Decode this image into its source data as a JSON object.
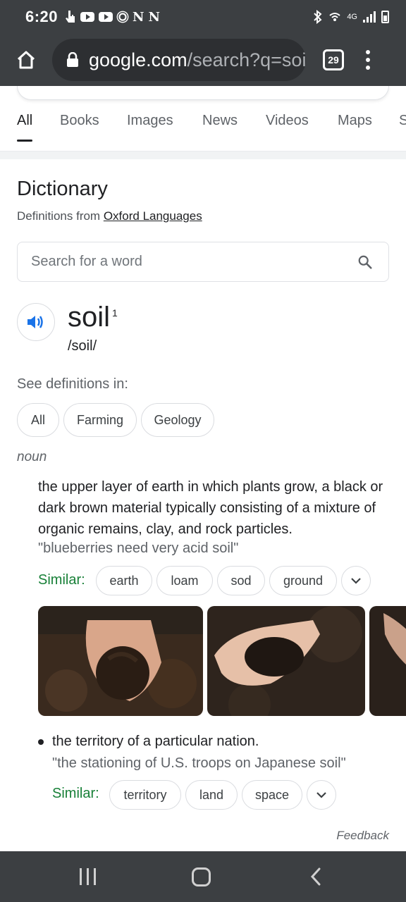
{
  "status_bar": {
    "time": "6:20",
    "n1": "N",
    "n2": "N",
    "network": "4G"
  },
  "browser": {
    "url_domain": "google.com",
    "url_path": "/search?q=soil",
    "tab_count": "29"
  },
  "search_tabs": [
    "All",
    "Books",
    "Images",
    "News",
    "Videos",
    "Maps",
    "S"
  ],
  "dictionary": {
    "title": "Dictionary",
    "source_prefix": "Definitions from ",
    "source_link": "Oxford Languages",
    "search_placeholder": "Search for a word",
    "word": "soil",
    "superscript": "1",
    "phonetic": "/soil/",
    "see_definitions_label": "See definitions in:",
    "filter_chips": [
      "All",
      "Farming",
      "Geology"
    ],
    "part_of_speech": "noun",
    "definitions": [
      {
        "text": "the upper layer of earth in which plants grow, a black or dark brown material typically consisting of a mixture of organic remains, clay, and rock particles.",
        "example": "\"blueberries need very acid soil\"",
        "similar_label": "Similar:",
        "similar": [
          "earth",
          "loam",
          "sod",
          "ground"
        ]
      },
      {
        "text": "the territory of a particular nation.",
        "example": "\"the stationing of U.S. troops on Japanese soil\"",
        "similar_label": "Similar:",
        "similar": [
          "territory",
          "land",
          "space"
        ]
      }
    ],
    "feedback": "Feedback"
  },
  "colors": {
    "chrome_bg": "#3c3f42",
    "similar_green": "#188038",
    "speaker_blue": "#1a73e8"
  }
}
